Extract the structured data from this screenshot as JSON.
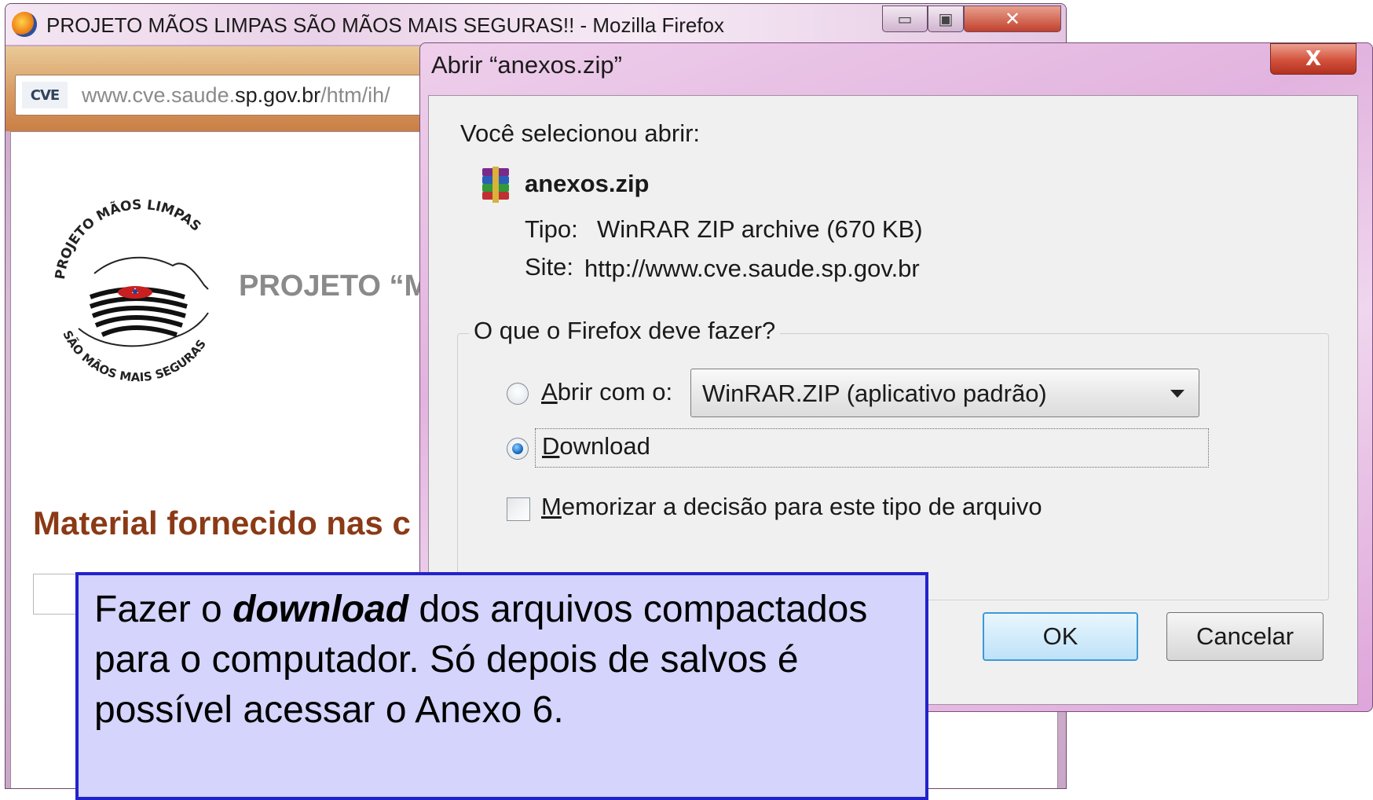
{
  "browser": {
    "title": "PROJETO MÃOS LIMPAS SÃO MÃOS MAIS SEGURAS!! - Mozilla Firefox",
    "url_badge": "CVE",
    "url_prefix": "www.cve.saude.",
    "url_domain": "sp.gov.br",
    "url_suffix": "/htm/ih/",
    "page_heading": "PROJETO “M",
    "page_material": "Material fornecido nas c",
    "logo_text_top": "PROJETO MÃOS LIMPAS",
    "logo_text_bottom": "SÃO MÃOS MAIS SEGURAS"
  },
  "dialog": {
    "title": "Abrir “anexos.zip”",
    "close_label": "X",
    "intro": "Você selecionou abrir:",
    "file_name": "anexos.zip",
    "type_label": "Tipo:",
    "type_value": "WinRAR ZIP archive (670  KB)",
    "site_label": "Site:",
    "site_value": "http://www.cve.saude.sp.gov.br",
    "group_label": "O que o Firefox deve fazer?",
    "open_with_key": "A",
    "open_with_rest": "brir com o:",
    "open_with_app": "WinRAR.ZIP (aplicativo padrão)",
    "download_key": "D",
    "download_rest": "ownload",
    "remember_key": "M",
    "remember_rest": "emorizar a decisão para este tipo de arquivo",
    "selected_option": "download",
    "remember_checked": false,
    "ok_label": "OK",
    "cancel_label": "Cancelar"
  },
  "callout": {
    "pre": "Fazer o ",
    "emphasis": "download",
    "post": " dos arquivos compactados para o computador. Só depois de salvos é possível acessar o Anexo 6."
  }
}
